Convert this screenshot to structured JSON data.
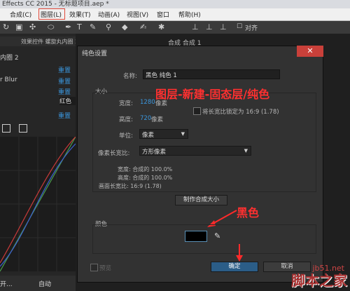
{
  "window": {
    "title": "Effects CC 2015 - 无标题项目.aep *"
  },
  "menu": [
    {
      "label": "合成(C)"
    },
    {
      "label": "图层(L)"
    },
    {
      "label": "效果(T)"
    },
    {
      "label": "动画(A)"
    },
    {
      "label": "视图(V)"
    },
    {
      "label": "窗口"
    },
    {
      "label": "帮助(H)"
    }
  ],
  "toolbar": {
    "align_label": "对齐"
  },
  "left_panel": {
    "tab_label": "效果控件 螺旋丸内圈 2",
    "layer_name": "内圈 2",
    "effect_label": "r Blur",
    "reset_1": "重置",
    "reset_2": "重置",
    "reset_3": "重置",
    "reset_4": "重置",
    "color_value": "红色",
    "bottom_left": "开...",
    "bottom_auto": "自动"
  },
  "right_panel": {
    "tab_label": "合成 合成 1"
  },
  "dialog": {
    "title": "纯色设置",
    "name_label": "名称:",
    "name_value": "黑色 纯色 1",
    "size_section": "大小",
    "width_label": "宽度:",
    "width_value": "1280",
    "width_unit": "像素",
    "height_label": "高度:",
    "height_value": "720",
    "height_unit": "像素",
    "lock_ratio_label": "将长宽比锁定为 16:9 (1.78)",
    "unit_label": "单位:",
    "unit_value": "像素",
    "pixel_aspect_label": "像素长宽比:",
    "pixel_aspect_value": "方形像素",
    "pct_width": "宽度: 合成的 100.0%",
    "pct_height": "高度: 合成的 100.0%",
    "frame_aspect": "画面长宽比: 16:9 (1.78)",
    "make_comp_size": "制作合成大小",
    "color_section": "颜色",
    "swatch_color": "#000000",
    "preview_label": "预览",
    "ok_label": "确定",
    "cancel_label": "取消"
  },
  "annotations": {
    "menu_path": "图层-新建-固态层/纯色",
    "black": "黑色"
  },
  "watermark": {
    "url": "jb51.net",
    "text": "脚本之家"
  }
}
